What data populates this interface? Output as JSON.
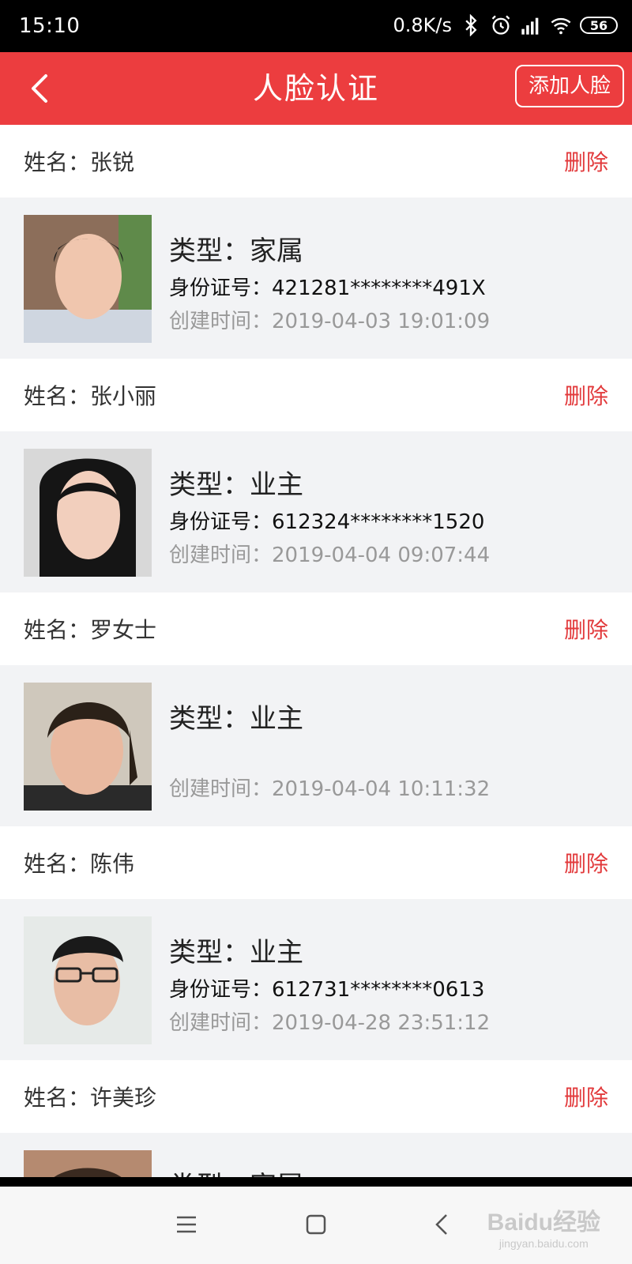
{
  "status_bar": {
    "time": "15:10",
    "net_speed": "0.8K/s",
    "battery": "56",
    "icons": [
      "bluetooth-icon",
      "alarm-icon",
      "signal-icon",
      "wifi-icon"
    ]
  },
  "header": {
    "title": "人脸认证",
    "add_button": "添加人脸",
    "background": "#ec3d3f"
  },
  "entries": [
    {
      "name": "姓名：张锐",
      "delete": "删除",
      "type": "类型：家属",
      "id": "身份证号：421281********491X",
      "created": "创建时间：2019-04-03 19:01:09"
    },
    {
      "name": "姓名：张小丽",
      "delete": "删除",
      "type": "类型：业主",
      "id": "身份证号：612324********1520",
      "created": "创建时间：2019-04-04 09:07:44"
    },
    {
      "name": "姓名：罗女士",
      "delete": "删除",
      "type": "类型：业主",
      "id": "",
      "created": "创建时间：2019-04-04 10:11:32"
    },
    {
      "name": "姓名：陈伟",
      "delete": "删除",
      "type": "类型：业主",
      "id": "身份证号：612731********0613",
      "created": "创建时间：2019-04-28 23:51:12"
    },
    {
      "name": "姓名：许美珍",
      "delete": "删除",
      "type": "类型：家属"
    }
  ],
  "watermark": {
    "brand": "Baidu经验",
    "url": "jingyan.baidu.com"
  },
  "colors": {
    "accent": "#ec3d3f",
    "delete": "#e23a3c",
    "muted": "#999999",
    "panel": "#f2f3f5"
  }
}
